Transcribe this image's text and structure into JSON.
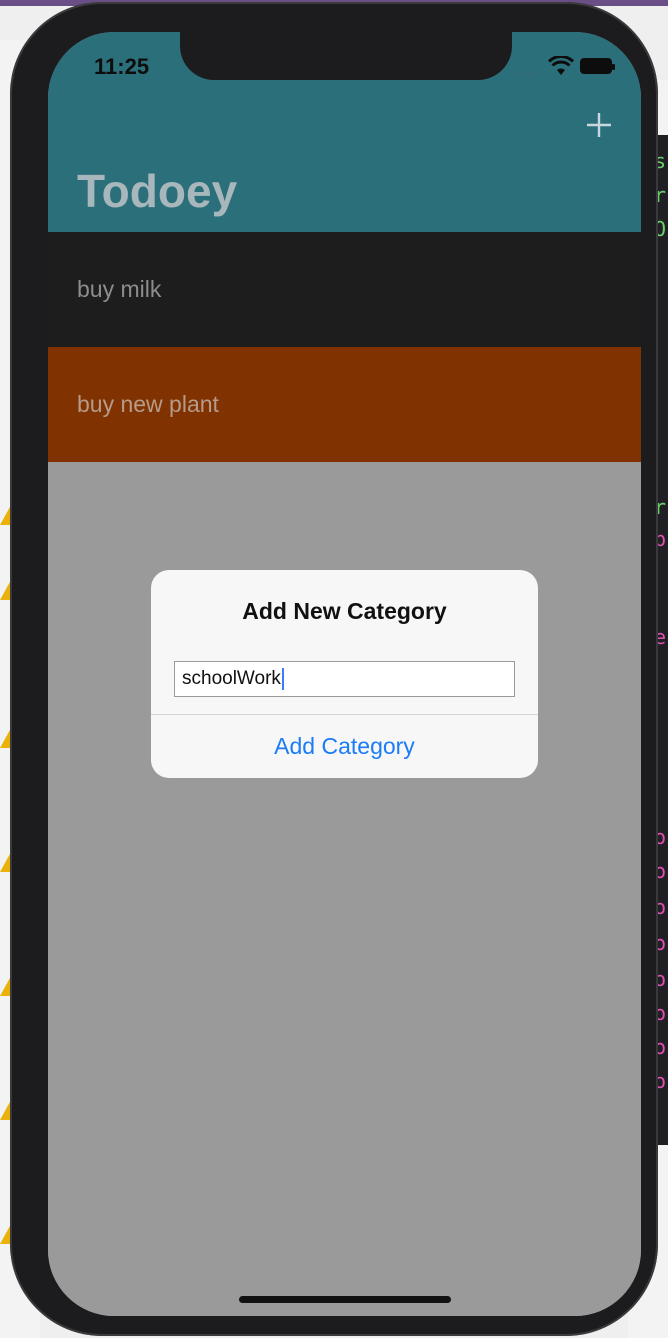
{
  "status_bar": {
    "time": "11:25",
    "signal": "....."
  },
  "nav": {
    "title": "Todoey",
    "add_icon": "plus-icon"
  },
  "list": {
    "items": [
      {
        "label": "buy milk",
        "bg": "#1d1d1e"
      },
      {
        "label": "buy new plant",
        "bg": "#803300"
      }
    ]
  },
  "alert": {
    "title": "Add New Category",
    "input_value": "schoolWork",
    "action_label": "Add Category"
  },
  "colors": {
    "nav_bg": "#2b6f7b",
    "action_blue": "#1a7cf6",
    "dim": "#9a9a9a"
  }
}
